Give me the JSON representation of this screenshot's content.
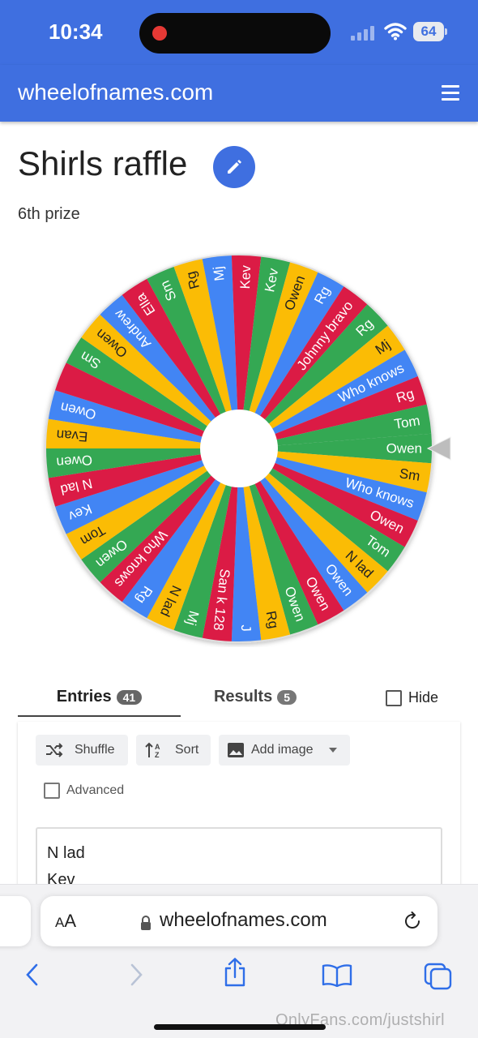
{
  "status_bar": {
    "time": "10:34",
    "battery": "64"
  },
  "app_bar": {
    "site_title": "wheelofnames.com"
  },
  "wheel": {
    "title": "Shirls raffle",
    "subtitle": "6th prize",
    "segment_colors": [
      "#34a853",
      "#fbbc05",
      "#4285f4",
      "#db1b45"
    ],
    "entries_on_wheel": [
      "Owen",
      "Sm",
      "Who knows",
      "Owen",
      "Tom",
      "N lad",
      "Owen",
      "Owen",
      "Owen",
      "Rg",
      "J",
      "San k 128",
      "Mj",
      "N lad",
      "Rg",
      "Who knows",
      "Owen",
      "Tom",
      "Kev",
      "N lad",
      "Owen",
      "Evan",
      "Owen",
      "",
      "Sm",
      "Owen",
      "Andrew",
      "Ella",
      "Sm",
      "Rg",
      "Mj",
      "Kev",
      "Kev",
      "Owen",
      "Rg",
      "Johnny bravo",
      "Rg",
      "Mj",
      "Who knows",
      "Rg",
      "Tom"
    ]
  },
  "tabs": {
    "entries_label": "Entries",
    "entries_count": "41",
    "results_label": "Results",
    "results_count": "5",
    "hide_label": "Hide"
  },
  "entries_panel": {
    "shuffle_label": "Shuffle",
    "sort_label": "Sort",
    "add_image_label": "Add image",
    "advanced_label": "Advanced",
    "visible_lines": [
      "N lad",
      "Kev"
    ]
  },
  "browser": {
    "aa_label_small": "A",
    "aa_label_large": "A",
    "address": "wheelofnames.com"
  },
  "watermark": "OnlyFans.com/justshirl"
}
